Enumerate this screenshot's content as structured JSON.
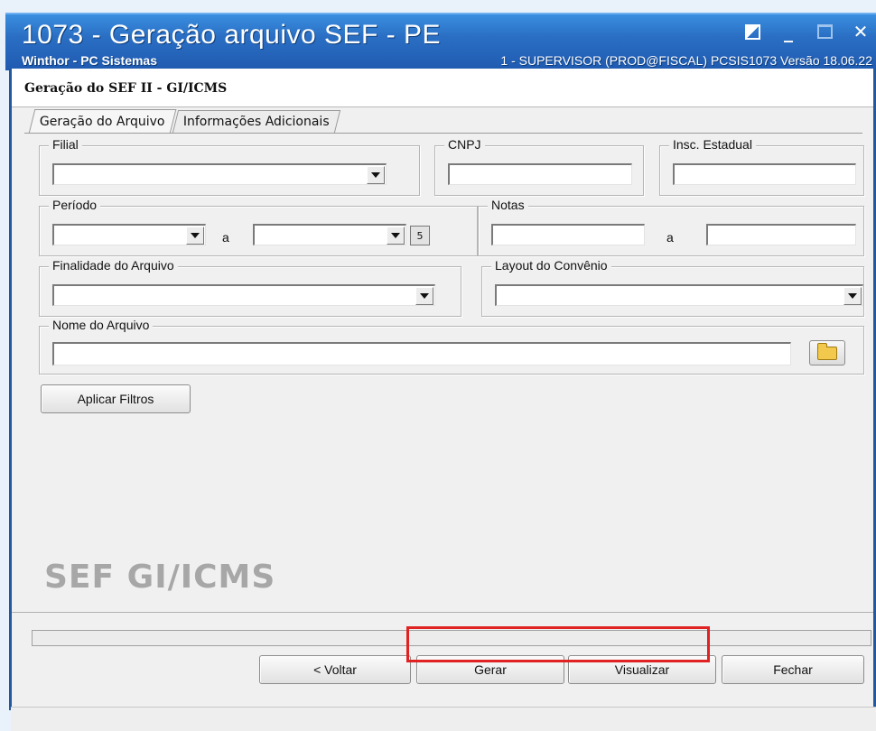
{
  "window": {
    "title": "1073 - Geração arquivo SEF - PE",
    "app_name": "Winthor - PC Sistemas",
    "session_info": "1 - SUPERVISOR (PROD@FISCAL)   PCSIS1073   Versão 18.06.22",
    "minimize_glyph": "_",
    "close_glyph": "✕"
  },
  "header": {
    "title": "Geração do SEF II - GI/ICMS"
  },
  "tabs": [
    {
      "label": "Geração do Arquivo",
      "active": true
    },
    {
      "label": "Informações Adicionais",
      "active": false
    }
  ],
  "form": {
    "filial": {
      "label": "Filial",
      "value": ""
    },
    "cnpj": {
      "label": "CNPJ",
      "value": ""
    },
    "insc_estadual": {
      "label": "Insc. Estadual",
      "value": ""
    },
    "periodo": {
      "label": "Período",
      "from": "",
      "separator": "a",
      "to": ""
    },
    "notas": {
      "label": "Notas",
      "from": "",
      "separator": "a",
      "to": ""
    },
    "finalidade": {
      "label": "Finalidade do Arquivo",
      "value": ""
    },
    "layout_convenio": {
      "label": "Layout do Convênio",
      "value": ""
    },
    "nome_arquivo": {
      "label": "Nome do Arquivo",
      "value": ""
    }
  },
  "buttons": {
    "aplicar_filtros": "Aplicar Filtros",
    "voltar": "< Voltar",
    "gerar": "Gerar",
    "visualizar": "Visualizar",
    "fechar": "Fechar"
  },
  "watermark": "SEF GI/ICMS",
  "highlight_color": "#e02222",
  "icons": [
    "calendar-icon",
    "folder-icon",
    "dropdown-arrow-icon"
  ]
}
